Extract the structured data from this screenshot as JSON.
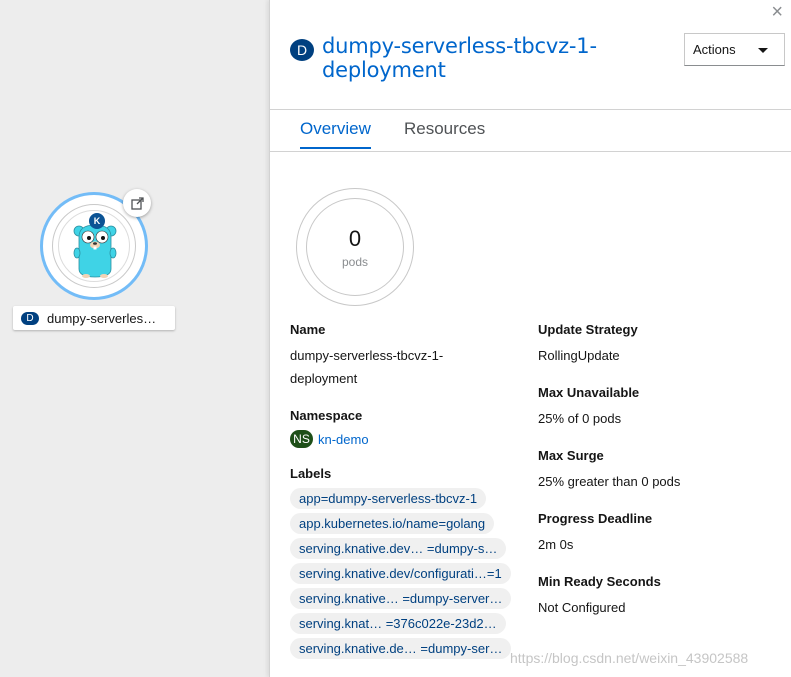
{
  "topology": {
    "node_label": "dumpy-serverles…",
    "node_badge": "D",
    "knative_badge": "K"
  },
  "panel": {
    "close_label": "×",
    "badge": "D",
    "title": "dumpy-serverless-tbcvz-1-deployment",
    "actions_label": "Actions",
    "tabs": [
      {
        "label": "Overview",
        "active": true
      },
      {
        "label": "Resources",
        "active": false
      }
    ],
    "pods": {
      "count": "0",
      "unit": "pods"
    },
    "details_left": {
      "name_label": "Name",
      "name_value_line1": "dumpy-serverless-tbcvz-1-",
      "name_value_line2": "deployment",
      "namespace_label": "Namespace",
      "namespace_badge": "NS",
      "namespace_value": "kn-demo",
      "labels_label": "Labels",
      "labels": [
        "app=dumpy-serverless-tbcvz-1",
        "app.kubernetes.io/name=golang",
        "serving.knative.dev… =dumpy-s…",
        "serving.knative.dev/configurati…=1",
        "serving.knative… =dumpy-server…",
        "serving.knat… =376c022e-23d2…",
        "serving.knative.de… =dumpy-ser…"
      ]
    },
    "details_right": {
      "update_strategy_label": "Update Strategy",
      "update_strategy_value": "RollingUpdate",
      "max_unavailable_label": "Max Unavailable",
      "max_unavailable_value": "25% of 0 pods",
      "max_surge_label": "Max Surge",
      "max_surge_value": "25% greater than 0 pods",
      "progress_deadline_label": "Progress Deadline",
      "progress_deadline_value": "2m 0s",
      "min_ready_label": "Min Ready Seconds",
      "min_ready_value": "Not Configured"
    }
  },
  "watermark": "https://blog.csdn.net/weixin_43902588",
  "colors": {
    "accent": "#0066cc",
    "deployment_badge": "#004080",
    "namespace_badge": "#1e4f18",
    "node_ring": "#73bcf7",
    "gopher_body": "#3fd3e6"
  }
}
